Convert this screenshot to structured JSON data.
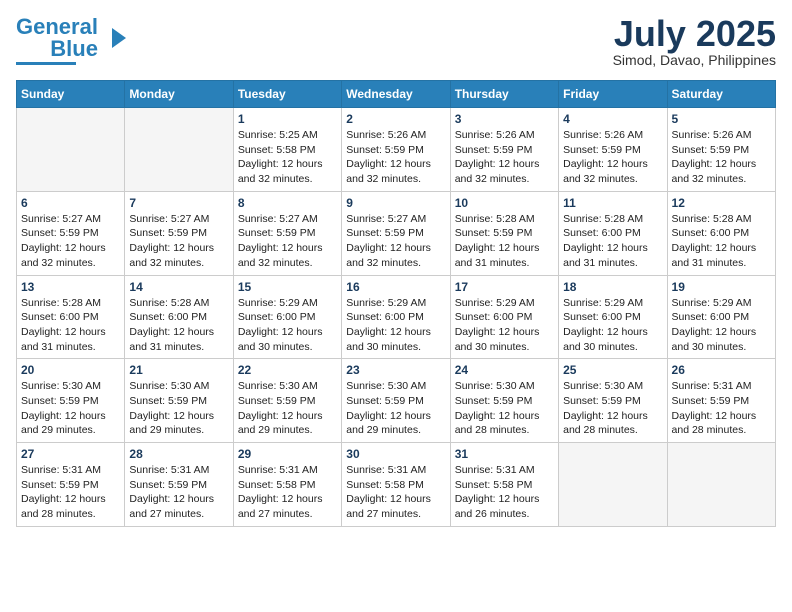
{
  "header": {
    "logo_general": "General",
    "logo_blue": "Blue",
    "month_year": "July 2025",
    "location": "Simod, Davao, Philippines"
  },
  "days_of_week": [
    "Sunday",
    "Monday",
    "Tuesday",
    "Wednesday",
    "Thursday",
    "Friday",
    "Saturday"
  ],
  "weeks": [
    [
      {
        "day": "",
        "info": ""
      },
      {
        "day": "",
        "info": ""
      },
      {
        "day": "1",
        "info": "Sunrise: 5:25 AM\nSunset: 5:58 PM\nDaylight: 12 hours and 32 minutes."
      },
      {
        "day": "2",
        "info": "Sunrise: 5:26 AM\nSunset: 5:59 PM\nDaylight: 12 hours and 32 minutes."
      },
      {
        "day": "3",
        "info": "Sunrise: 5:26 AM\nSunset: 5:59 PM\nDaylight: 12 hours and 32 minutes."
      },
      {
        "day": "4",
        "info": "Sunrise: 5:26 AM\nSunset: 5:59 PM\nDaylight: 12 hours and 32 minutes."
      },
      {
        "day": "5",
        "info": "Sunrise: 5:26 AM\nSunset: 5:59 PM\nDaylight: 12 hours and 32 minutes."
      }
    ],
    [
      {
        "day": "6",
        "info": "Sunrise: 5:27 AM\nSunset: 5:59 PM\nDaylight: 12 hours and 32 minutes."
      },
      {
        "day": "7",
        "info": "Sunrise: 5:27 AM\nSunset: 5:59 PM\nDaylight: 12 hours and 32 minutes."
      },
      {
        "day": "8",
        "info": "Sunrise: 5:27 AM\nSunset: 5:59 PM\nDaylight: 12 hours and 32 minutes."
      },
      {
        "day": "9",
        "info": "Sunrise: 5:27 AM\nSunset: 5:59 PM\nDaylight: 12 hours and 32 minutes."
      },
      {
        "day": "10",
        "info": "Sunrise: 5:28 AM\nSunset: 5:59 PM\nDaylight: 12 hours and 31 minutes."
      },
      {
        "day": "11",
        "info": "Sunrise: 5:28 AM\nSunset: 6:00 PM\nDaylight: 12 hours and 31 minutes."
      },
      {
        "day": "12",
        "info": "Sunrise: 5:28 AM\nSunset: 6:00 PM\nDaylight: 12 hours and 31 minutes."
      }
    ],
    [
      {
        "day": "13",
        "info": "Sunrise: 5:28 AM\nSunset: 6:00 PM\nDaylight: 12 hours and 31 minutes."
      },
      {
        "day": "14",
        "info": "Sunrise: 5:28 AM\nSunset: 6:00 PM\nDaylight: 12 hours and 31 minutes."
      },
      {
        "day": "15",
        "info": "Sunrise: 5:29 AM\nSunset: 6:00 PM\nDaylight: 12 hours and 30 minutes."
      },
      {
        "day": "16",
        "info": "Sunrise: 5:29 AM\nSunset: 6:00 PM\nDaylight: 12 hours and 30 minutes."
      },
      {
        "day": "17",
        "info": "Sunrise: 5:29 AM\nSunset: 6:00 PM\nDaylight: 12 hours and 30 minutes."
      },
      {
        "day": "18",
        "info": "Sunrise: 5:29 AM\nSunset: 6:00 PM\nDaylight: 12 hours and 30 minutes."
      },
      {
        "day": "19",
        "info": "Sunrise: 5:29 AM\nSunset: 6:00 PM\nDaylight: 12 hours and 30 minutes."
      }
    ],
    [
      {
        "day": "20",
        "info": "Sunrise: 5:30 AM\nSunset: 5:59 PM\nDaylight: 12 hours and 29 minutes."
      },
      {
        "day": "21",
        "info": "Sunrise: 5:30 AM\nSunset: 5:59 PM\nDaylight: 12 hours and 29 minutes."
      },
      {
        "day": "22",
        "info": "Sunrise: 5:30 AM\nSunset: 5:59 PM\nDaylight: 12 hours and 29 minutes."
      },
      {
        "day": "23",
        "info": "Sunrise: 5:30 AM\nSunset: 5:59 PM\nDaylight: 12 hours and 29 minutes."
      },
      {
        "day": "24",
        "info": "Sunrise: 5:30 AM\nSunset: 5:59 PM\nDaylight: 12 hours and 28 minutes."
      },
      {
        "day": "25",
        "info": "Sunrise: 5:30 AM\nSunset: 5:59 PM\nDaylight: 12 hours and 28 minutes."
      },
      {
        "day": "26",
        "info": "Sunrise: 5:31 AM\nSunset: 5:59 PM\nDaylight: 12 hours and 28 minutes."
      }
    ],
    [
      {
        "day": "27",
        "info": "Sunrise: 5:31 AM\nSunset: 5:59 PM\nDaylight: 12 hours and 28 minutes."
      },
      {
        "day": "28",
        "info": "Sunrise: 5:31 AM\nSunset: 5:59 PM\nDaylight: 12 hours and 27 minutes."
      },
      {
        "day": "29",
        "info": "Sunrise: 5:31 AM\nSunset: 5:58 PM\nDaylight: 12 hours and 27 minutes."
      },
      {
        "day": "30",
        "info": "Sunrise: 5:31 AM\nSunset: 5:58 PM\nDaylight: 12 hours and 27 minutes."
      },
      {
        "day": "31",
        "info": "Sunrise: 5:31 AM\nSunset: 5:58 PM\nDaylight: 12 hours and 26 minutes."
      },
      {
        "day": "",
        "info": ""
      },
      {
        "day": "",
        "info": ""
      }
    ]
  ]
}
